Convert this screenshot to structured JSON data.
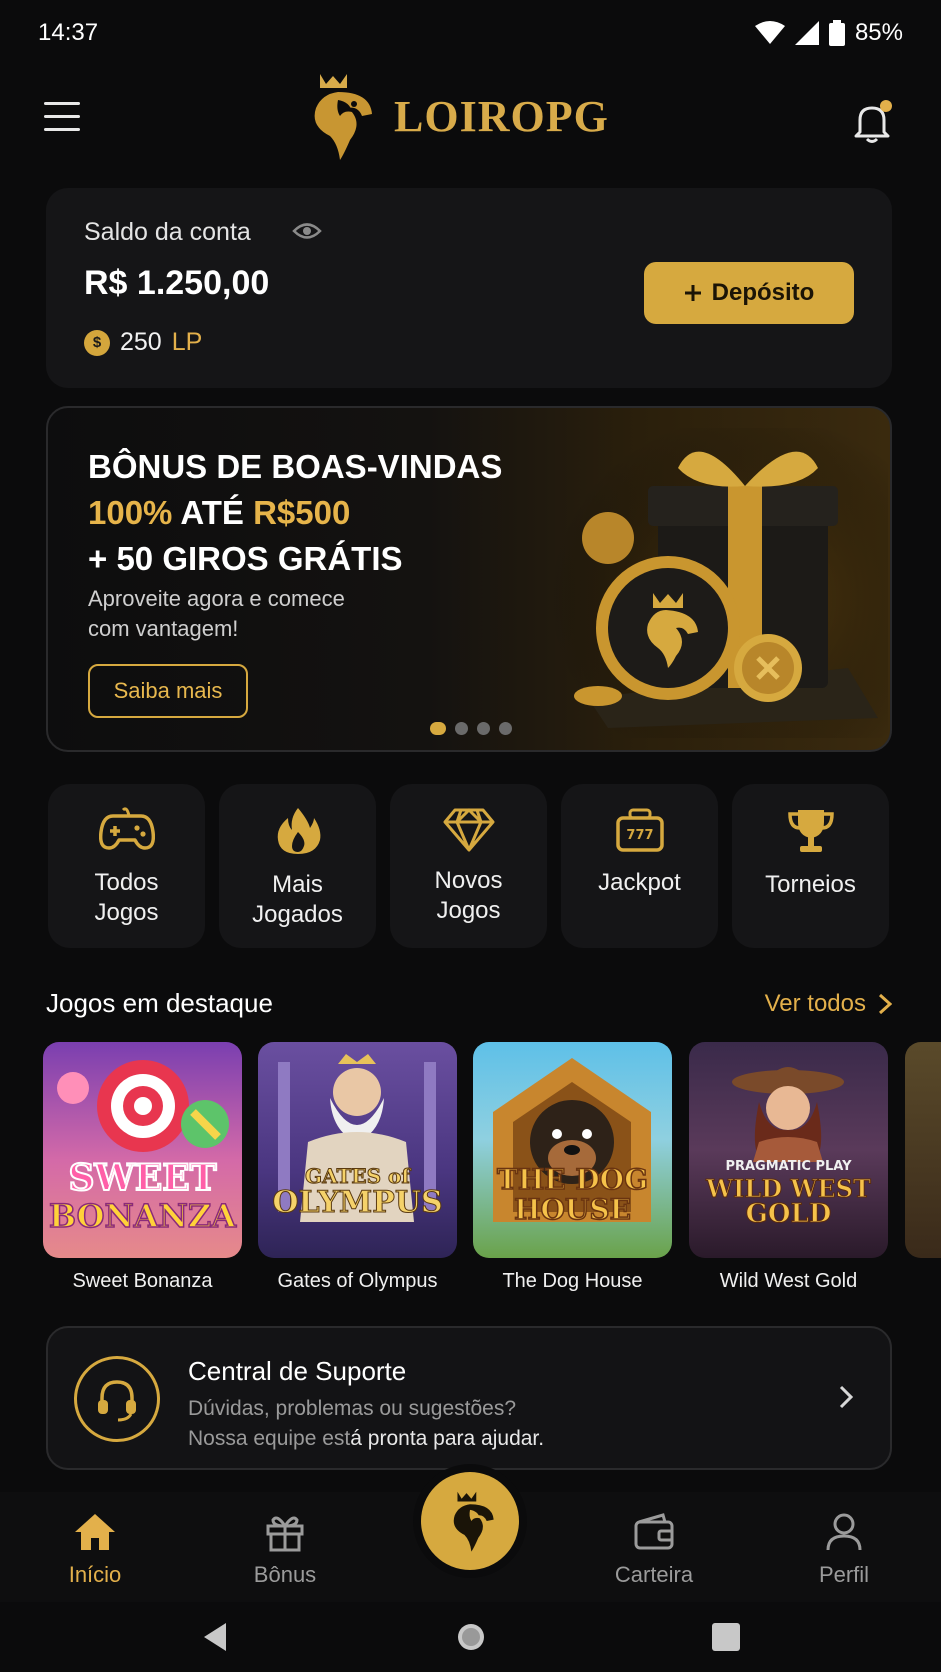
{
  "status_bar": {
    "time": "14:37",
    "battery": "85%"
  },
  "header": {
    "brand": "LOIROPG"
  },
  "balance": {
    "label": "Saldo da conta",
    "amount": "R$ 1.250,00",
    "points_value": "250",
    "points_unit": "LP",
    "deposit_label": "Depósito"
  },
  "banner": {
    "line1": "BÔNUS DE BOAS-VINDAS",
    "line2_a": "100%",
    "line2_b": " ATÉ ",
    "line2_c": "R$500",
    "line3": "+ 50 GIROS GRÁTIS",
    "subtitle": "Aproveite agora e comece com vantagem!",
    "cta": "Saiba mais",
    "slide_count": 4,
    "active_slide": 1
  },
  "categories": [
    {
      "label": "Todos\nJogos",
      "icon": "gamepad-icon"
    },
    {
      "label": "Mais\nJogados",
      "icon": "flame-icon"
    },
    {
      "label": "Novos\nJogos",
      "icon": "diamond-icon"
    },
    {
      "label": "Jackpot",
      "icon": "slot-machine-icon"
    },
    {
      "label": "Torneios",
      "icon": "trophy-icon"
    }
  ],
  "featured": {
    "title": "Jogos em destaque",
    "see_all": "Ver todos",
    "games": [
      {
        "name": "Sweet Bonanza",
        "art_line1": "SWEET",
        "art_line2": "BONANZA"
      },
      {
        "name": "Gates of Olympus",
        "art_line1": "GATES of",
        "art_line2": "OLYMPUS"
      },
      {
        "name": "The Dog House",
        "art_line1": "THE DOG",
        "art_line2": "HOUSE"
      },
      {
        "name": "Wild West Gold",
        "art_top": "PRAGMATIC PLAY",
        "art_line1": "WILD WEST",
        "art_line2": "GOLD"
      }
    ]
  },
  "support": {
    "title": "Central de Suporte",
    "line1": "Dúvidas, problemas ou sugestões?",
    "line2_a": "Nossa equipe est",
    "line2_b": "á pronta para ajudar."
  },
  "bottom_nav": [
    {
      "label": "Início",
      "active": true
    },
    {
      "label": "Bônus",
      "active": false
    },
    {
      "label": "Carteira",
      "active": false
    },
    {
      "label": "Perfil",
      "active": false
    }
  ],
  "colors": {
    "accent": "#d6a93f",
    "background": "#0b0b0c",
    "card": "#151517"
  }
}
